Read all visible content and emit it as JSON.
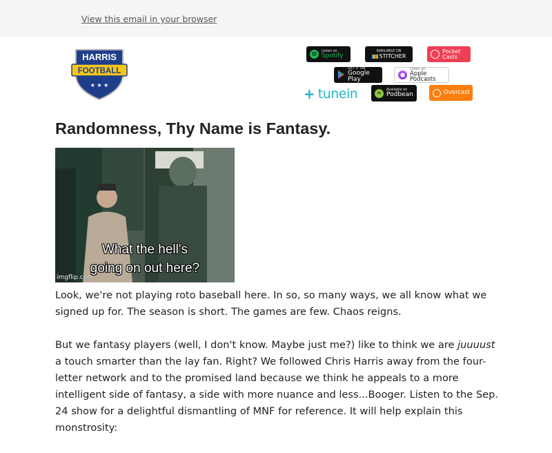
{
  "header": {
    "view_in_browser": "View this email in your browser"
  },
  "logo": {
    "line1": "HARRIS",
    "line2": "FOOTBALL",
    "stars": "★ ★ ★"
  },
  "podcast_badges": {
    "spotify": {
      "small": "Listen on",
      "large": "Spotify",
      "icon": "spotify-icon"
    },
    "stitcher": {
      "small": "AVAILABLE ON",
      "large": "STITCHER",
      "icon": "stitcher-icon"
    },
    "pocketcasts": {
      "large": "Pocket Casts",
      "line1": "Pocket",
      "line2": "Casts",
      "icon": "pocketcasts-icon"
    },
    "googleplay": {
      "small": "GET IT ON",
      "large": "Google Play",
      "icon": "google-play-icon"
    },
    "applepodcasts": {
      "small": "Listen on",
      "large": "Apple Podcasts",
      "icon": "apple-podcasts-icon"
    },
    "tunein": {
      "large": "tunein",
      "icon": "tunein-icon"
    },
    "podbean": {
      "small": "Available on",
      "large": "Podbean",
      "icon": "podbean-icon"
    },
    "overcast": {
      "large": "Overcast",
      "icon": "overcast-icon"
    }
  },
  "article": {
    "title": "Randomness, Thy Name is Fantasy.",
    "gif": {
      "caption_line1": "What the hell's",
      "caption_line2": "going on out here?",
      "watermark": "imgflip.com"
    },
    "p1": "Look, we're not playing roto baseball here. In so, so many ways, we all know what we signed up for. The season is short. The games are few. Chaos reigns.",
    "p2_before": "But we fantasy players (well, I don't know. Maybe just me?) like to think we are ",
    "p2_italic": "juuuust",
    "p2_after": " a touch smarter than the lay fan. Right? We followed Chris Harris away from the four-letter network and to the promised land because we think he appeals to a more intelligent side of fantasy, a side with more nuance and less...Booger. Listen to the Sep. 24 show for a delightful dismantling of MNF for reference. It will help explain this monstrosity:"
  },
  "colors": {
    "topbar": "#f5f5f5",
    "shield_blue": "#1f3e8a",
    "ribbon_yellow": "#f6c519",
    "spotify_green": "#1db954",
    "pocket_red": "#ef3f56",
    "overcast_orange": "#fc7e0f",
    "tunein_teal": "#20b7c5"
  }
}
